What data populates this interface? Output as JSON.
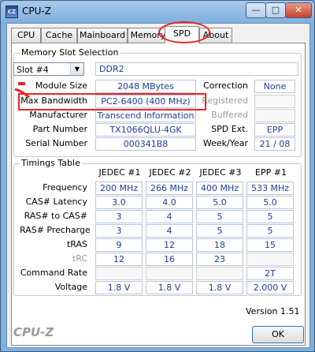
{
  "window": {
    "title": "CPU-Z",
    "icon": "cpu-z-app-icon"
  },
  "titlebar_buttons": {
    "minimize": "—",
    "maximize": "□",
    "close": "✕"
  },
  "tabs": [
    {
      "label": "CPU"
    },
    {
      "label": "Cache"
    },
    {
      "label": "Mainboard"
    },
    {
      "label": "Memory"
    },
    {
      "label": "SPD"
    },
    {
      "label": "About"
    }
  ],
  "active_tab": "SPD",
  "slot": {
    "legend": "Memory Slot Selection",
    "selected": "Slot #4",
    "type": "DDR2",
    "labels": {
      "module_size": "Module Size",
      "max_bandwidth": "Max Bandwidth",
      "manufacturer": "Manufacturer",
      "part_number": "Part Number",
      "serial_number": "Serial Number",
      "correction": "Correction",
      "registered": "Registered",
      "buffered": "Buffered",
      "spd_ext": "SPD Ext.",
      "week_year": "Week/Year"
    },
    "values": {
      "module_size": "2048 MBytes",
      "max_bandwidth": "PC2-6400 (400 MHz)",
      "manufacturer": "Transcend Information",
      "part_number": "TX1066QLU-4GK",
      "serial_number": "000341B8",
      "correction": "None",
      "registered": "",
      "buffered": "",
      "spd_ext": "EPP",
      "week_year": "21 / 08"
    }
  },
  "timings": {
    "legend": "Timings Table",
    "columns": [
      "JEDEC #1",
      "JEDEC #2",
      "JEDEC #3",
      "EPP #1"
    ],
    "rows": [
      {
        "label": "Frequency",
        "values": [
          "200 MHz",
          "266 MHz",
          "400 MHz",
          "533 MHz"
        ]
      },
      {
        "label": "CAS# Latency",
        "values": [
          "3.0",
          "4.0",
          "5.0",
          "5.0"
        ]
      },
      {
        "label": "RAS# to CAS#",
        "values": [
          "3",
          "4",
          "5",
          "5"
        ]
      },
      {
        "label": "RAS# Precharge",
        "values": [
          "3",
          "4",
          "5",
          "5"
        ]
      },
      {
        "label": "tRAS",
        "values": [
          "9",
          "12",
          "18",
          "15"
        ]
      },
      {
        "label": "tRC",
        "values": [
          "12",
          "16",
          "23",
          ""
        ]
      },
      {
        "label": "Command Rate",
        "values": [
          "",
          "",
          "",
          "2T"
        ]
      },
      {
        "label": "Voltage",
        "values": [
          "1.8 V",
          "1.8 V",
          "1.8 V",
          "2.000 V"
        ]
      }
    ]
  },
  "footer": {
    "version": "Version 1.51",
    "brand": "CPU-Z",
    "ok_label": "OK"
  },
  "colors": {
    "value_text": "#1a3fa0",
    "annotation_red": "#e22222",
    "titlebar": "#7fb0de"
  }
}
